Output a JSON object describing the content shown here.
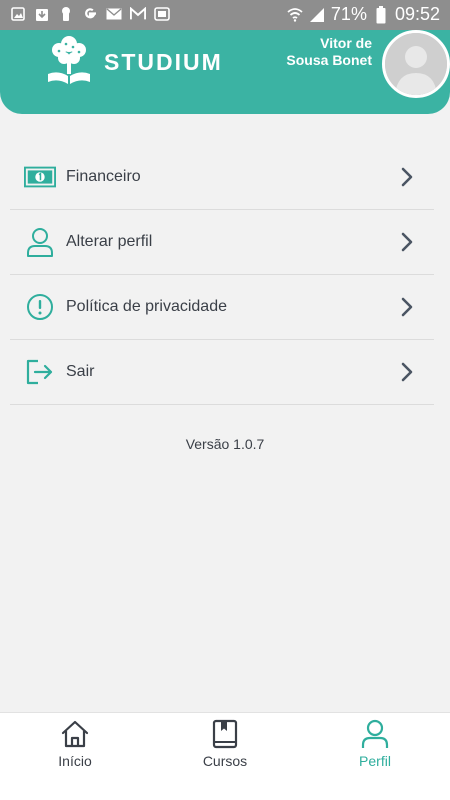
{
  "status_bar": {
    "battery_percent": "71%",
    "time": "09:52",
    "left_icons": [
      "gallery-icon",
      "download-icon",
      "keyhole-icon",
      "google-icon",
      "envelope-icon",
      "gmail-icon",
      "screenshot-icon"
    ],
    "right_icons": [
      "wifi-icon",
      "signal-icon",
      "battery-icon"
    ]
  },
  "header": {
    "brand": "STUDIUM",
    "user_name": "Vitor de Sousa Bonet",
    "logo_icon": "tree-book-icon",
    "avatar_icon": "avatar-placeholder"
  },
  "menu": {
    "items": [
      {
        "label": "Financeiro",
        "icon": "money-icon"
      },
      {
        "label": "Alterar perfil",
        "icon": "user-icon"
      },
      {
        "label": "Política de privacidade",
        "icon": "alert-circle-icon"
      },
      {
        "label": "Sair",
        "icon": "logout-icon"
      }
    ]
  },
  "version": "Versão 1.0.7",
  "bottom_nav": {
    "items": [
      {
        "label": "Início",
        "icon": "home-icon"
      },
      {
        "label": "Cursos",
        "icon": "book-icon"
      },
      {
        "label": "Perfil",
        "icon": "user-icon"
      }
    ],
    "active": "Perfil"
  },
  "colors": {
    "accent": "#3bb3a3",
    "active_nav": "#2fae9d",
    "text": "#3a3f47",
    "background": "#f2f2f2"
  }
}
